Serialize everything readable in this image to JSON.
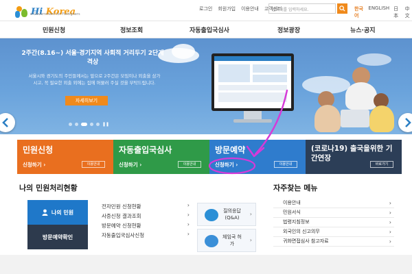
{
  "logo": {
    "main": "Hi",
    "brand": "Korea",
    "sub": "e-Government for Foreigners"
  },
  "util_links": [
    "로그인",
    "회원가입",
    "이용안내",
    "고객센터"
  ],
  "search": {
    "placeholder": "검색어를 입력하세요."
  },
  "languages": [
    "한국어",
    "ENGLISH",
    "日本",
    "中文"
  ],
  "nav": [
    "민원신청",
    "정보조회",
    "자동출입국심사",
    "정보광장",
    "뉴스·공지"
  ],
  "hero": {
    "title": "2주간(8.16~) 서울·경기지역 사회적 거리두기 2단계 격상",
    "desc": "서울시와 경기도의 주민들께서는 앞으로 2주간은 모임이나 외출을 삼가시고, 꼭 필요한 외출 외에는 집에 머물러 주실 것을 부탁드립니다.",
    "button": "자세히보기"
  },
  "tiles": [
    {
      "title": "민원신청",
      "link": "신청하기 ›",
      "btn": "이용안내",
      "color": "#e96f1f"
    },
    {
      "title": "자동출입국심사",
      "link": "신청하기 ›",
      "btn": "이용안내",
      "color": "#2f9a48"
    },
    {
      "title": "방문예약",
      "link": "신청하기 ›",
      "btn": "이용안내",
      "color": "#2f7ccd"
    },
    {
      "title": "(코로나19) 출국을위한 기간연장",
      "link": "",
      "btn": "바로가기",
      "color": "#2c3e57"
    }
  ],
  "status": {
    "title": "나의 민원처리현황",
    "my_button": "나의 민원",
    "visit_button": "방문예약확인",
    "items": [
      "전자민원 신청현황",
      "사증신청 결과조회",
      "방문예약 신청현황",
      "자동출입국심사신청"
    ],
    "cards": [
      {
        "label": "질의응답 (Q&A)"
      },
      {
        "label": "체임국 허가"
      }
    ]
  },
  "faq": {
    "title": "자주찾는 메뉴",
    "items": [
      "이용안내",
      "민원서식",
      "법령지침정보",
      "외국인의 신고의무",
      "귀화면접심사 참고자료"
    ]
  },
  "colors": {
    "accent": "#f08a1c",
    "brand_blue": "#2b7fc4",
    "highlight": "#d63ad8"
  }
}
